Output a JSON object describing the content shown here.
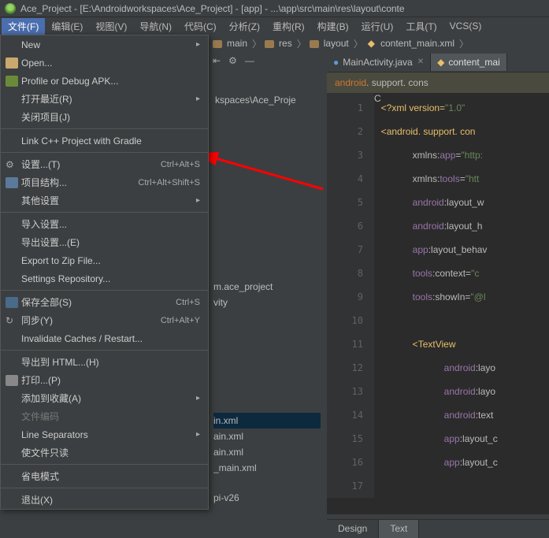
{
  "titlebar": {
    "text": "Ace_Project - [E:\\Androidworkspaces\\Ace_Project] - [app] - ...\\app\\src\\main\\res\\layout\\conte"
  },
  "menubar": {
    "items": [
      {
        "label": "文件(F)",
        "active": true
      },
      {
        "label": "编辑(E)"
      },
      {
        "label": "视图(V)"
      },
      {
        "label": "导航(N)"
      },
      {
        "label": "代码(C)"
      },
      {
        "label": "分析(Z)"
      },
      {
        "label": "重构(R)"
      },
      {
        "label": "构建(B)"
      },
      {
        "label": "运行(U)"
      },
      {
        "label": "工具(T)"
      },
      {
        "label": "VCS(S)"
      }
    ]
  },
  "breadcrumb": {
    "seg1": "main",
    "seg2": "res",
    "seg3": "layout",
    "seg4": "content_main.xml"
  },
  "dropdown": {
    "items": [
      {
        "label": "New",
        "arrow": true
      },
      {
        "label": "Open...",
        "icon": "folder"
      },
      {
        "label": "Profile or Debug APK...",
        "icon": "debug"
      },
      {
        "label": "打开最近(R)",
        "arrow": true
      },
      {
        "label": "关闭项目(J)"
      },
      {
        "sep": true
      },
      {
        "label": "Link C++ Project with Gradle"
      },
      {
        "sep": true
      },
      {
        "label": "设置...(T)",
        "icon": "gear",
        "shortcut": "Ctrl+Alt+S"
      },
      {
        "label": "项目结构...",
        "icon": "struct",
        "shortcut": "Ctrl+Alt+Shift+S"
      },
      {
        "label": "其他设置",
        "arrow": true
      },
      {
        "sep": true
      },
      {
        "label": "导入设置..."
      },
      {
        "label": "导出设置...(E)"
      },
      {
        "label": "Export to Zip File..."
      },
      {
        "label": "Settings Repository..."
      },
      {
        "sep": true
      },
      {
        "label": "保存全部(S)",
        "icon": "save",
        "shortcut": "Ctrl+S"
      },
      {
        "label": "同步(Y)",
        "icon": "sync",
        "shortcut": "Ctrl+Alt+Y"
      },
      {
        "label": "Invalidate Caches / Restart..."
      },
      {
        "sep": true
      },
      {
        "label": "导出到 HTML...(H)"
      },
      {
        "label": "打印...(P)",
        "icon": "print"
      },
      {
        "label": "添加到收藏(A)",
        "arrow": true
      },
      {
        "label": "文件编码",
        "disabled": true
      },
      {
        "label": "Line Separators",
        "arrow": true
      },
      {
        "label": "使文件只读"
      },
      {
        "sep": true
      },
      {
        "label": "省电模式"
      },
      {
        "sep": true
      },
      {
        "label": "退出(X)"
      }
    ]
  },
  "project_frags": {
    "a": "kspaces\\Ace_Proje",
    "b": "m.ace_project",
    "c": "vity",
    "d": "in.xml",
    "e": "ain.xml",
    "f": "ain.xml",
    "g": "_main.xml",
    "h": "pi-v26"
  },
  "tabs": {
    "tab1": "MainActivity.java",
    "tab2": "content_mai"
  },
  "hint": {
    "kw": "android",
    "rest": ". support. cons"
  },
  "code": {
    "l1_a": "<?",
    "l1_b": "xml version=",
    "l1_c": "\"1.0\"",
    "l2_a": "<",
    "l2_b": "android. support. con",
    "l3_a": "xmlns:",
    "l3_b": "app",
    "l3_c": "=",
    "l3_d": "\"http:",
    "l4_a": "xmlns:",
    "l4_b": "tools",
    "l4_c": "=",
    "l4_d": "\"htt",
    "l5_a": "android",
    "l5_b": ":layout_w",
    "l6_a": "android",
    "l6_b": ":layout_h",
    "l7_a": "app",
    "l7_b": ":layout_behav",
    "l8_a": "tools",
    "l8_b": ":context=",
    "l8_c": "\"c",
    "l9_a": "tools",
    "l9_b": ":showIn=",
    "l9_c": "\"@l",
    "l11_a": "<",
    "l11_b": "TextView",
    "l12_a": "android",
    "l12_b": ":layo",
    "l13_a": "android",
    "l13_b": ":layo",
    "l14_a": "android",
    "l14_b": ":text",
    "l15_a": "app",
    "l15_b": ":layout_c",
    "l16_a": "app",
    "l16_b": ":layout_c"
  },
  "line_numbers": [
    "1",
    "2",
    "3",
    "4",
    "5",
    "6",
    "7",
    "8",
    "9",
    "10",
    "11",
    "12",
    "13",
    "14",
    "15",
    "16",
    "17"
  ],
  "bottom_tabs": {
    "tab1": "Design",
    "tab2": "Text"
  }
}
